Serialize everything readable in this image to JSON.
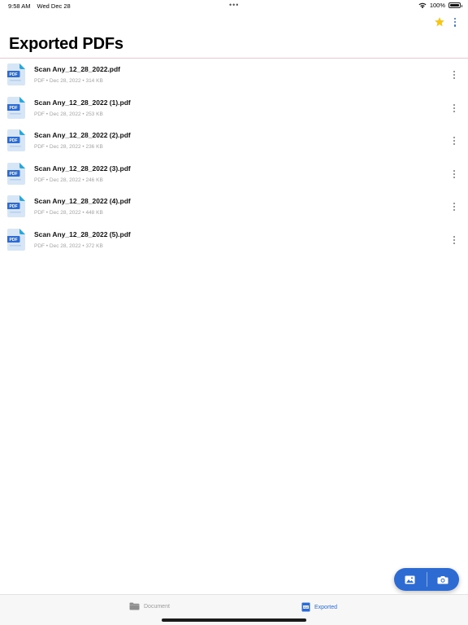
{
  "status_bar": {
    "time": "9:58 AM",
    "date": "Wed Dec 28",
    "dots": "•••",
    "battery_percent": "100%",
    "battery_level": 1.0,
    "icons": [
      "wifi-icon",
      "battery-icon"
    ]
  },
  "header": {
    "title": "Exported PDFs",
    "actions": [
      "star-icon",
      "more-vertical-icon"
    ]
  },
  "files": [
    {
      "name": "Scan Any_12_28_2022.pdf",
      "type": "PDF",
      "date": "Dec 28, 2022",
      "size": "314 KB",
      "badge": "PDF"
    },
    {
      "name": "Scan Any_12_28_2022 (1).pdf",
      "type": "PDF",
      "date": "Dec 28, 2022",
      "size": "253 KB",
      "badge": "PDF"
    },
    {
      "name": "Scan Any_12_28_2022 (2).pdf",
      "type": "PDF",
      "date": "Dec 28, 2022",
      "size": "236 KB",
      "badge": "PDF"
    },
    {
      "name": "Scan Any_12_28_2022 (3).pdf",
      "type": "PDF",
      "date": "Dec 28, 2022",
      "size": "246 KB",
      "badge": "PDF"
    },
    {
      "name": "Scan Any_12_28_2022 (4).pdf",
      "type": "PDF",
      "date": "Dec 28, 2022",
      "size": "448 KB",
      "badge": "PDF"
    },
    {
      "name": "Scan Any_12_28_2022 (5).pdf",
      "type": "PDF",
      "date": "Dec 28, 2022",
      "size": "372 KB",
      "badge": "PDF"
    }
  ],
  "fab": {
    "buttons": [
      "image-icon",
      "camera-icon"
    ]
  },
  "tab_bar": {
    "tabs": [
      {
        "label": "Document",
        "icon": "folder-icon",
        "active": false
      },
      {
        "label": "Exported",
        "icon": "pdf-icon",
        "active": true
      }
    ]
  },
  "colors": {
    "accent": "#2d6bd3",
    "star": "#f5c518",
    "divider": "#f1c8cd",
    "meta_text": "#a3a3a3"
  }
}
